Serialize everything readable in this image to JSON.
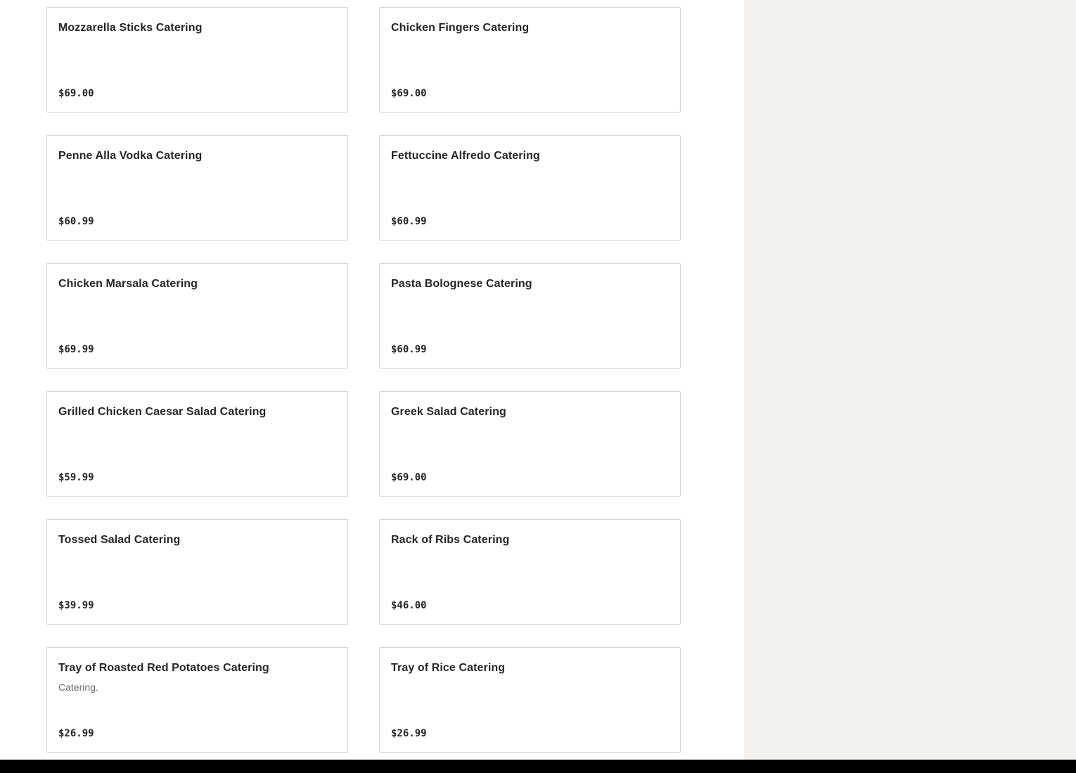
{
  "menu": {
    "items": [
      {
        "name": "Mozzarella Sticks Catering",
        "description": "",
        "price": "$69.00"
      },
      {
        "name": "Chicken Fingers Catering",
        "description": "",
        "price": "$69.00"
      },
      {
        "name": "Penne Alla Vodka Catering",
        "description": "",
        "price": "$60.99"
      },
      {
        "name": "Fettuccine Alfredo Catering",
        "description": "",
        "price": "$60.99"
      },
      {
        "name": "Chicken Marsala Catering",
        "description": "",
        "price": "$69.99"
      },
      {
        "name": "Pasta Bolognese Catering",
        "description": "",
        "price": "$60.99"
      },
      {
        "name": "Grilled Chicken Caesar Salad Catering",
        "description": "",
        "price": "$59.99"
      },
      {
        "name": "Greek Salad Catering",
        "description": "",
        "price": "$69.00"
      },
      {
        "name": "Tossed Salad Catering",
        "description": "",
        "price": "$39.99"
      },
      {
        "name": "Rack of Ribs Catering",
        "description": "",
        "price": "$46.00"
      },
      {
        "name": "Tray of Roasted Red Potatoes Catering",
        "description": "Catering.",
        "price": "$26.99"
      },
      {
        "name": "Tray of Rice Catering",
        "description": "",
        "price": "$26.99"
      }
    ]
  },
  "colors": {
    "card_border": "#d4d4d4",
    "side_panel_bg": "#f3f2ef",
    "bottom_bar": "#000000",
    "text_primary": "#262626",
    "text_secondary": "#6b6b6b"
  }
}
